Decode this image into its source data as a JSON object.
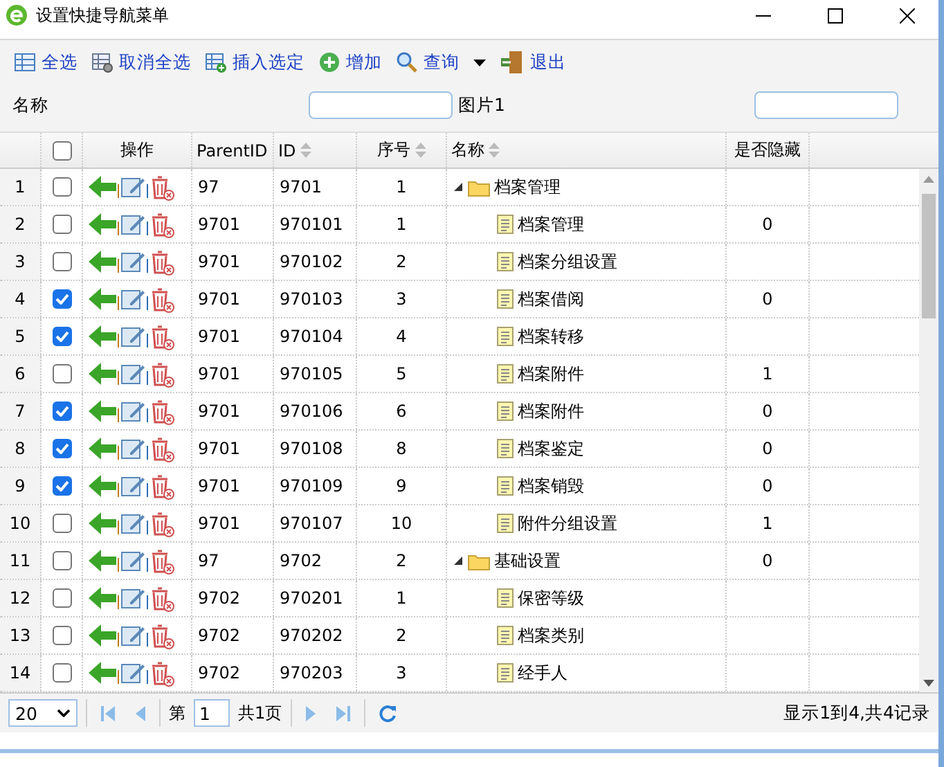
{
  "window": {
    "title": "设置快捷导航菜单"
  },
  "toolbar": [
    {
      "kind": "select-all",
      "label": "全选"
    },
    {
      "kind": "deselect",
      "label": "取消全选"
    },
    {
      "kind": "insert",
      "label": "插入选定"
    },
    {
      "kind": "add",
      "label": "增加"
    },
    {
      "kind": "query",
      "label": "查询"
    },
    {
      "kind": "exit",
      "label": "退出"
    }
  ],
  "filters": {
    "name_label": "名称",
    "image_label": "图片1"
  },
  "table": {
    "header_checkbox": {
      "checked": false
    },
    "columns": [
      "操作",
      "ParentID",
      "ID",
      "序号",
      "名称",
      "是否隐藏"
    ],
    "rows": [
      {
        "num": "1",
        "checked": false,
        "parent_id": "97",
        "id": "9701",
        "order": "1",
        "name": "档案管理",
        "kind": "folder",
        "expanded": true,
        "children": [
          {
            "num": "2",
            "checked": false,
            "parent_id": "9701",
            "id": "970101",
            "order": "1",
            "name": "档案管理",
            "hidden": "0",
            "kind": "file"
          },
          {
            "num": "3",
            "checked": false,
            "parent_id": "9701",
            "id": "970102",
            "order": "2",
            "name": "档案分组设置",
            "kind": "file"
          },
          {
            "num": "4",
            "checked": true,
            "parent_id": "9701",
            "id": "970103",
            "order": "3",
            "name": "档案借阅",
            "hidden": "0",
            "kind": "file"
          },
          {
            "num": "5",
            "checked": true,
            "parent_id": "9701",
            "id": "970104",
            "order": "4",
            "name": "档案转移",
            "kind": "file"
          },
          {
            "num": "6",
            "checked": false,
            "parent_id": "9701",
            "id": "970105",
            "order": "5",
            "name": "档案附件",
            "hidden": "1",
            "kind": "file"
          },
          {
            "num": "7",
            "checked": true,
            "parent_id": "9701",
            "id": "970106",
            "order": "6",
            "name": "档案附件",
            "hidden": "0",
            "kind": "file"
          },
          {
            "num": "8",
            "checked": true,
            "parent_id": "9701",
            "id": "970108",
            "order": "8",
            "name": "档案鉴定",
            "hidden": "0",
            "kind": "file"
          },
          {
            "num": "9",
            "checked": true,
            "parent_id": "9701",
            "id": "970109",
            "order": "9",
            "name": "档案销毁",
            "hidden": "0",
            "kind": "file"
          },
          {
            "num": "10",
            "checked": false,
            "parent_id": "9701",
            "id": "970107",
            "order": "10",
            "name": "附件分组设置",
            "hidden": "1",
            "kind": "file"
          }
        ]
      },
      {
        "num": "11",
        "checked": false,
        "parent_id": "97",
        "id": "9702",
        "order": "2",
        "name": "基础设置",
        "hidden": "0",
        "kind": "folder",
        "expanded": true,
        "children": [
          {
            "num": "12",
            "checked": false,
            "parent_id": "9702",
            "id": "970201",
            "order": "1",
            "name": "保密等级",
            "kind": "file"
          },
          {
            "num": "13",
            "checked": false,
            "parent_id": "9702",
            "id": "970202",
            "order": "2",
            "name": "档案类别",
            "kind": "file"
          },
          {
            "num": "14",
            "checked": false,
            "parent_id": "9702",
            "id": "970203",
            "order": "3",
            "name": "经手人",
            "kind": "file"
          }
        ]
      }
    ]
  },
  "pager": {
    "page_size": "20",
    "page_prefix": "第",
    "page": "1",
    "page_suffix": "共1页",
    "summary": "显示1到4,共4记录"
  }
}
